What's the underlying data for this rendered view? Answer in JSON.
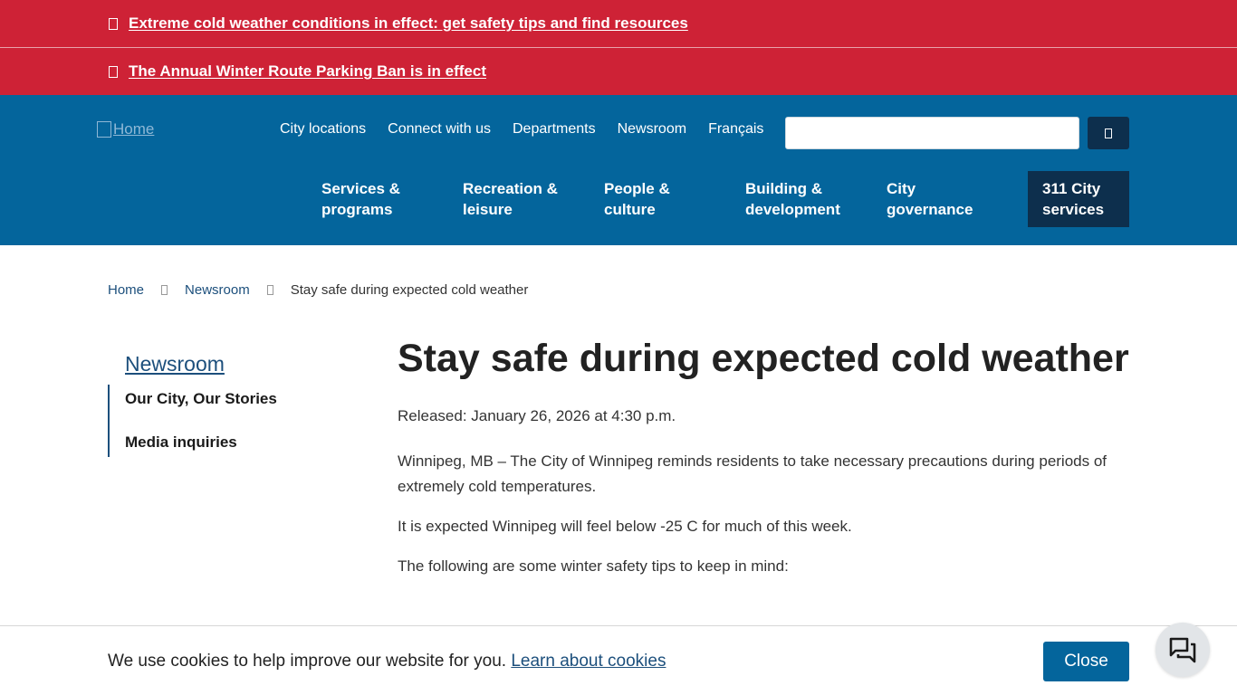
{
  "alerts": [
    {
      "text": "Extreme cold weather conditions in effect: get safety tips and find resources"
    },
    {
      "text": "The Annual Winter Route Parking Ban is in effect"
    }
  ],
  "header": {
    "logo_alt": "Home",
    "utility_links": [
      "City locations",
      "Connect with us",
      "Departments",
      "Newsroom",
      "Français"
    ],
    "search": {
      "placeholder": ""
    },
    "main_nav": [
      {
        "line1": "Services &",
        "line2": "programs"
      },
      {
        "line1": "Recreation &",
        "line2": "leisure"
      },
      {
        "line1": "People &",
        "line2": "culture"
      },
      {
        "line1": "Building &",
        "line2": "development"
      },
      {
        "line1": "City",
        "line2": "governance"
      }
    ],
    "cta_311": {
      "line1": "311 City",
      "line2": "services"
    }
  },
  "breadcrumb": {
    "items": [
      "Home",
      "Newsroom"
    ],
    "current": "Stay safe during expected cold weather"
  },
  "sidebar": {
    "title": "Newsroom",
    "items": [
      "Our City, Our Stories",
      "Media inquiries"
    ]
  },
  "article": {
    "title": "Stay safe during expected cold weather",
    "released": "Released: January 26, 2026 at 4:30 p.m.",
    "paragraphs": [
      "Winnipeg, MB – The City of Winnipeg reminds residents to take necessary precautions during periods of extremely cold temperatures.",
      "It is expected Winnipeg will feel below -25 C for much of this week.",
      "The following are some winter safety tips to keep in mind:"
    ]
  },
  "cookie_banner": {
    "message": "We use cookies to help improve our website for you.",
    "link": "Learn about cookies",
    "close_label": "Close"
  },
  "icons": {
    "alert": "warning-icon",
    "search": "search-icon",
    "breadcrumb_sep": "chevron-right-icon",
    "chat": "chat-icon"
  },
  "colors": {
    "alert_bg": "#ce2236",
    "header_bg": "#04659c",
    "dark_navy": "#0d2f4d",
    "link": "#1c4f7c"
  }
}
